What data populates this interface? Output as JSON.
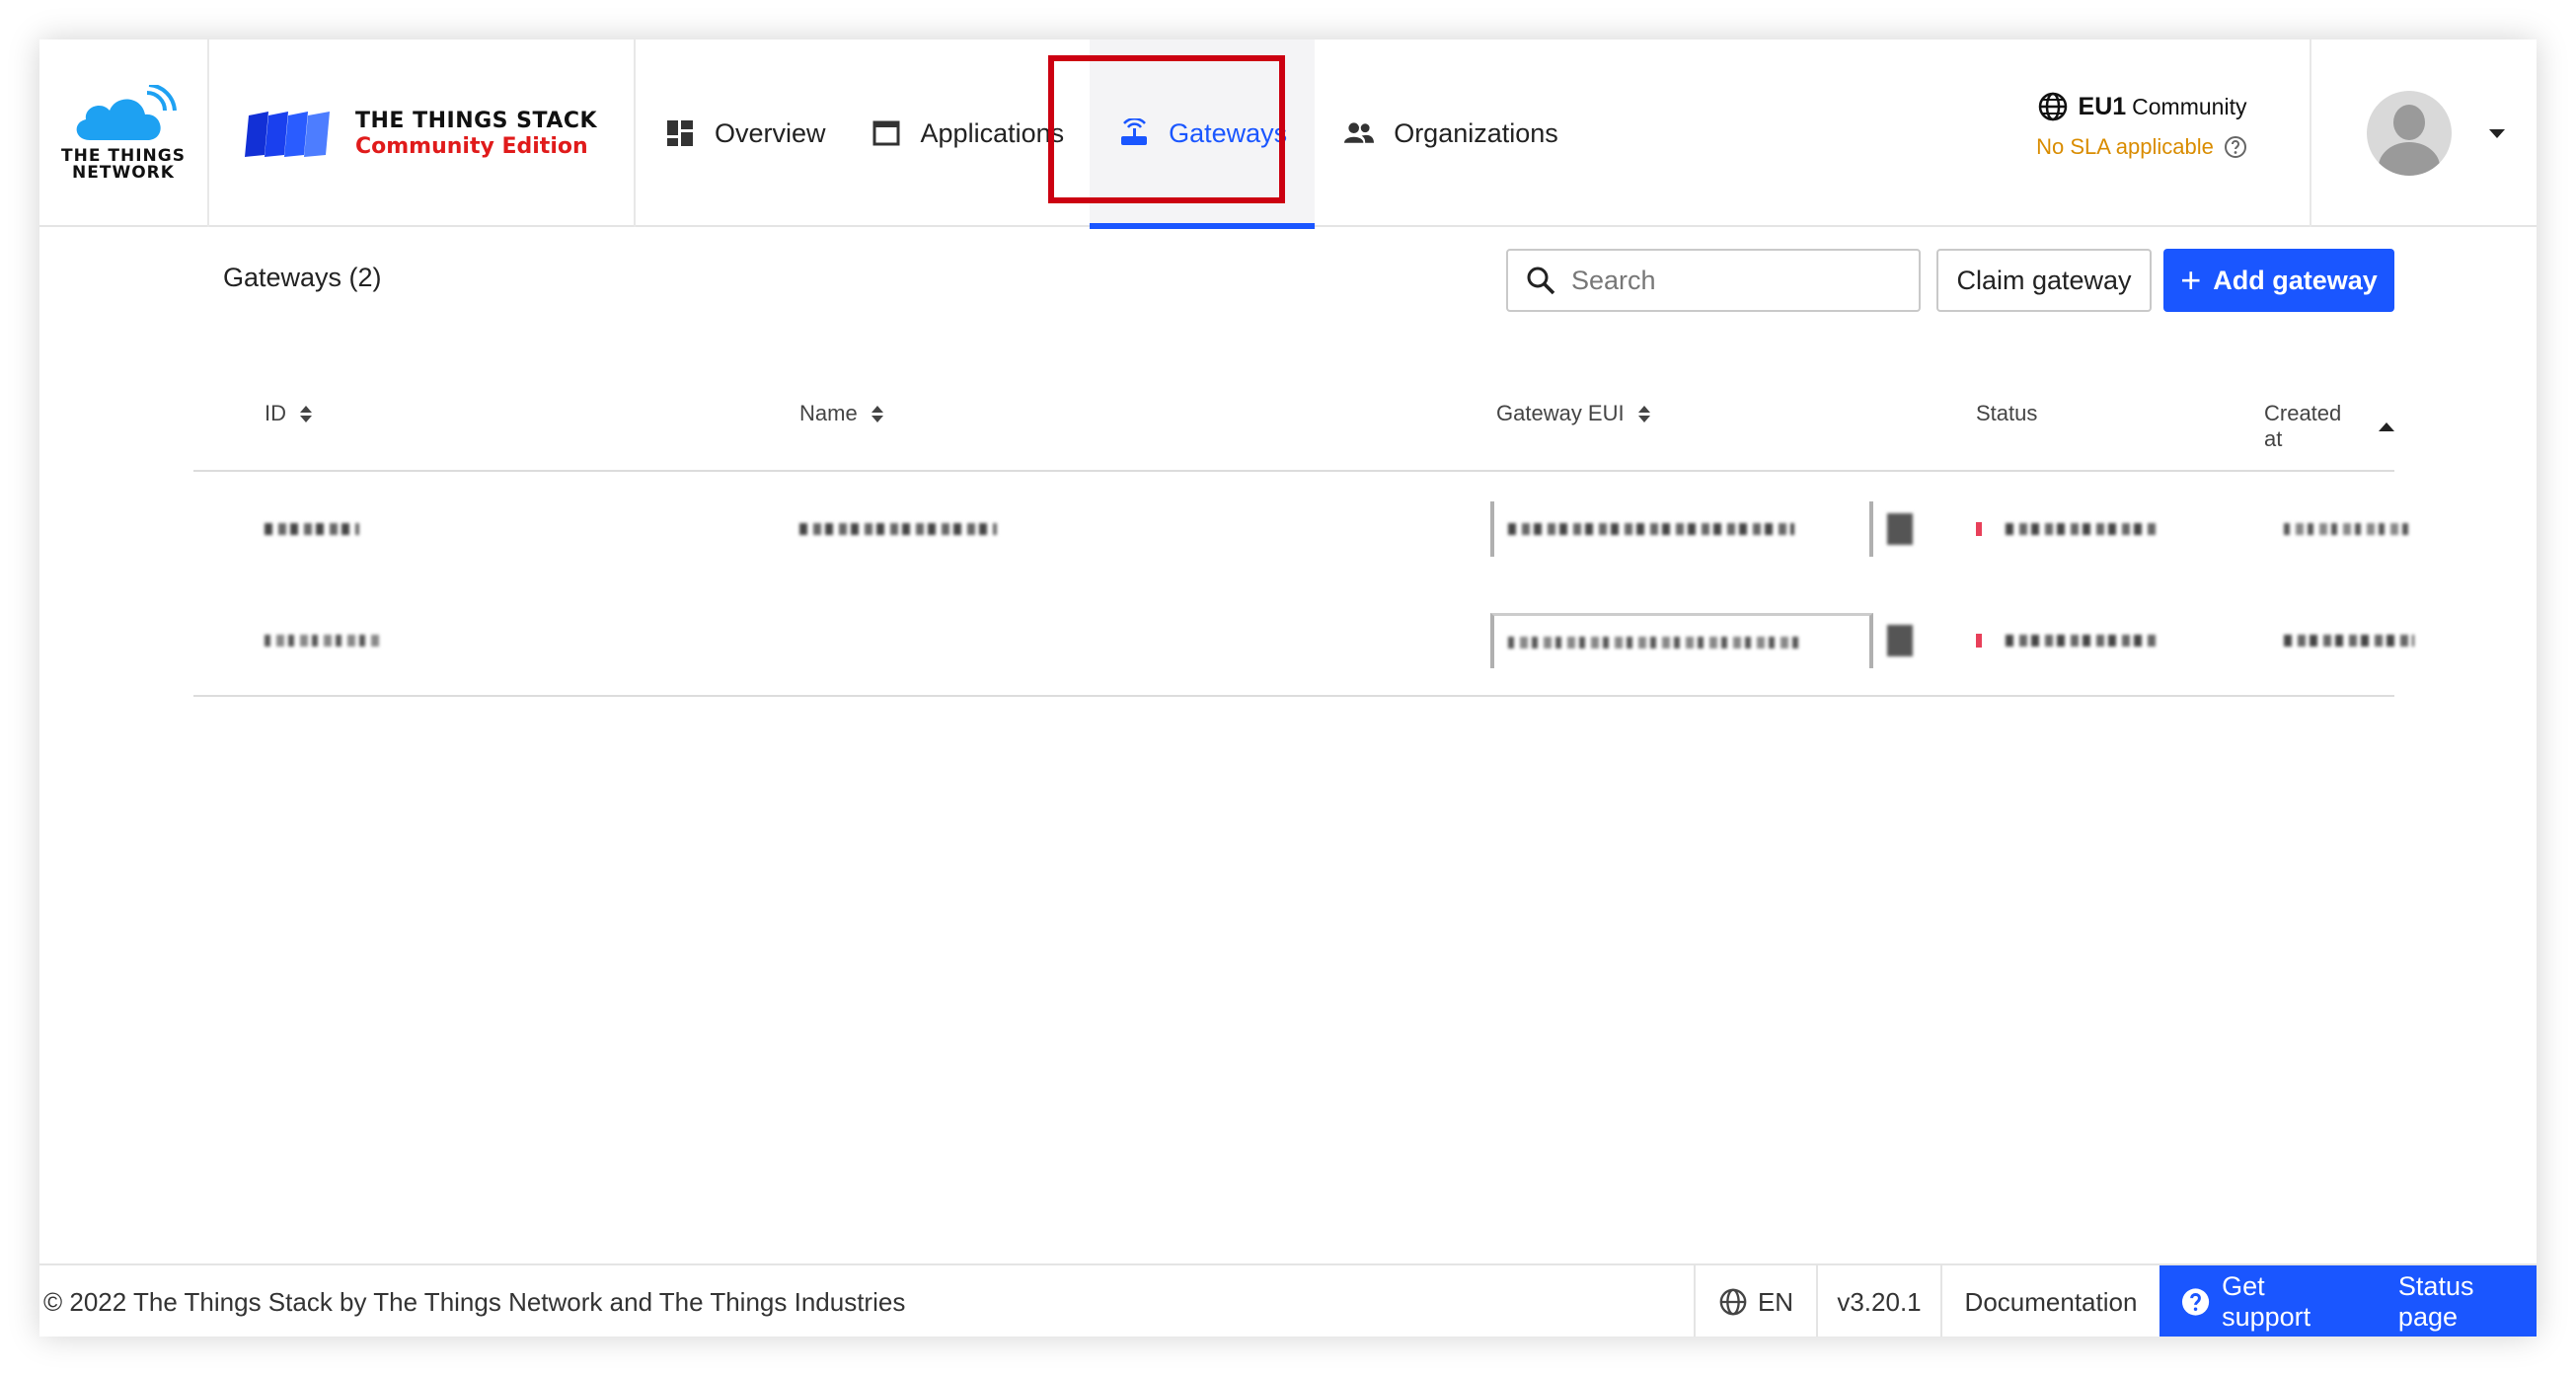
{
  "header": {
    "ttn_logo_line1": "THE THINGS",
    "ttn_logo_line2": "NETWORK",
    "tts_title": "THE THINGS STACK",
    "tts_subtitle": "Community Edition",
    "nav": [
      {
        "label": "Overview",
        "icon": "dashboard-icon"
      },
      {
        "label": "Applications",
        "icon": "application-window-icon"
      },
      {
        "label": "Gateways",
        "icon": "gateway-router-icon",
        "active": true
      },
      {
        "label": "Organizations",
        "icon": "people-icon"
      }
    ],
    "cluster": {
      "name": "EU1",
      "suffix": "Community",
      "sla": "No SLA applicable"
    }
  },
  "main": {
    "title": "Gateways (2)",
    "search_placeholder": "Search",
    "claim_label": "Claim gateway",
    "add_label": "Add gateway",
    "columns": [
      "ID",
      "Name",
      "Gateway EUI",
      "Status",
      "Created at"
    ],
    "rows": [
      {
        "id": "",
        "name": "",
        "eui": "",
        "status": "",
        "created": ""
      },
      {
        "id": "",
        "name": "",
        "eui": "",
        "status": "",
        "created": ""
      }
    ]
  },
  "footer": {
    "copyright": "© 2022 The Things Stack by The Things Network and The Things Industries",
    "language": "EN",
    "version": "v3.20.1",
    "docs": "Documentation",
    "support": "Get support",
    "status_page": "Status page"
  },
  "colors": {
    "accent": "#1a56ff",
    "highlight": "#cc0011",
    "sla": "#d98c00",
    "status_offline": "#e8405a"
  }
}
